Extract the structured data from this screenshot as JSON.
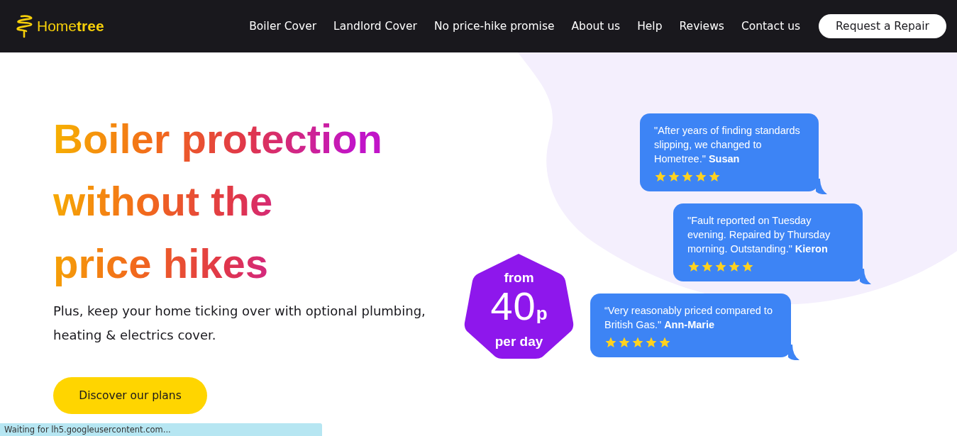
{
  "header": {
    "logo": "Home**tree**",
    "nav": [
      "Boiler Cover",
      "Landlord Cover",
      "No price-hike promise",
      "About us",
      "Help",
      "Reviews",
      "Contact us"
    ],
    "cta": "Request a Repair"
  },
  "hero": {
    "headline": [
      "Boiler protection",
      "without the",
      "price hikes"
    ],
    "subtitle": "Plus, keep your home ticking over with optional plumbing, heating & electrics cover.",
    "button": "Discover our plans"
  },
  "price_badge": {
    "prefix": "from",
    "amount": "40",
    "unit": "p",
    "suffix": "per day"
  },
  "reviews": [
    {
      "text": "\"After years of finding standards slipping, we changed to Hometree.\"  **Susan**",
      "stars": 5
    },
    {
      "text": "\"Fault reported on Tuesday evening. Repaired by Thursday morning. Outstanding.\"  **Kieron**",
      "stars": 5
    },
    {
      "text": "“Very reasonably priced compared to British Gas.\"  **Ann-Marie**",
      "stars": 5
    }
  ],
  "status_bar": "Waiting for lh5.googleusercontent.com..."
}
